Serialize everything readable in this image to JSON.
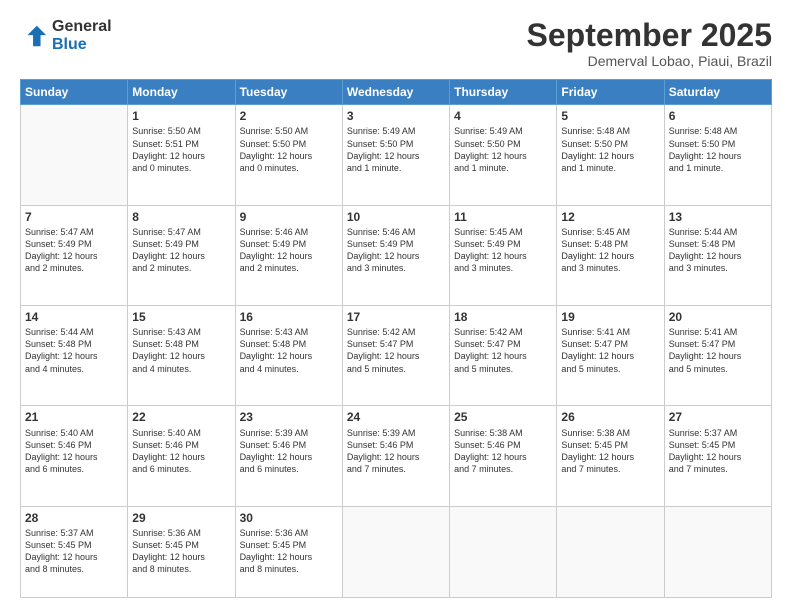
{
  "logo": {
    "general": "General",
    "blue": "Blue"
  },
  "header": {
    "month_title": "September 2025",
    "subtitle": "Demerval Lobao, Piaui, Brazil"
  },
  "days_of_week": [
    "Sunday",
    "Monday",
    "Tuesday",
    "Wednesday",
    "Thursday",
    "Friday",
    "Saturday"
  ],
  "weeks": [
    [
      {
        "day": "",
        "info": ""
      },
      {
        "day": "1",
        "info": "Sunrise: 5:50 AM\nSunset: 5:51 PM\nDaylight: 12 hours\nand 0 minutes."
      },
      {
        "day": "2",
        "info": "Sunrise: 5:50 AM\nSunset: 5:50 PM\nDaylight: 12 hours\nand 0 minutes."
      },
      {
        "day": "3",
        "info": "Sunrise: 5:49 AM\nSunset: 5:50 PM\nDaylight: 12 hours\nand 1 minute."
      },
      {
        "day": "4",
        "info": "Sunrise: 5:49 AM\nSunset: 5:50 PM\nDaylight: 12 hours\nand 1 minute."
      },
      {
        "day": "5",
        "info": "Sunrise: 5:48 AM\nSunset: 5:50 PM\nDaylight: 12 hours\nand 1 minute."
      },
      {
        "day": "6",
        "info": "Sunrise: 5:48 AM\nSunset: 5:50 PM\nDaylight: 12 hours\nand 1 minute."
      }
    ],
    [
      {
        "day": "7",
        "info": "Sunrise: 5:47 AM\nSunset: 5:49 PM\nDaylight: 12 hours\nand 2 minutes."
      },
      {
        "day": "8",
        "info": "Sunrise: 5:47 AM\nSunset: 5:49 PM\nDaylight: 12 hours\nand 2 minutes."
      },
      {
        "day": "9",
        "info": "Sunrise: 5:46 AM\nSunset: 5:49 PM\nDaylight: 12 hours\nand 2 minutes."
      },
      {
        "day": "10",
        "info": "Sunrise: 5:46 AM\nSunset: 5:49 PM\nDaylight: 12 hours\nand 3 minutes."
      },
      {
        "day": "11",
        "info": "Sunrise: 5:45 AM\nSunset: 5:49 PM\nDaylight: 12 hours\nand 3 minutes."
      },
      {
        "day": "12",
        "info": "Sunrise: 5:45 AM\nSunset: 5:48 PM\nDaylight: 12 hours\nand 3 minutes."
      },
      {
        "day": "13",
        "info": "Sunrise: 5:44 AM\nSunset: 5:48 PM\nDaylight: 12 hours\nand 3 minutes."
      }
    ],
    [
      {
        "day": "14",
        "info": "Sunrise: 5:44 AM\nSunset: 5:48 PM\nDaylight: 12 hours\nand 4 minutes."
      },
      {
        "day": "15",
        "info": "Sunrise: 5:43 AM\nSunset: 5:48 PM\nDaylight: 12 hours\nand 4 minutes."
      },
      {
        "day": "16",
        "info": "Sunrise: 5:43 AM\nSunset: 5:48 PM\nDaylight: 12 hours\nand 4 minutes."
      },
      {
        "day": "17",
        "info": "Sunrise: 5:42 AM\nSunset: 5:47 PM\nDaylight: 12 hours\nand 5 minutes."
      },
      {
        "day": "18",
        "info": "Sunrise: 5:42 AM\nSunset: 5:47 PM\nDaylight: 12 hours\nand 5 minutes."
      },
      {
        "day": "19",
        "info": "Sunrise: 5:41 AM\nSunset: 5:47 PM\nDaylight: 12 hours\nand 5 minutes."
      },
      {
        "day": "20",
        "info": "Sunrise: 5:41 AM\nSunset: 5:47 PM\nDaylight: 12 hours\nand 5 minutes."
      }
    ],
    [
      {
        "day": "21",
        "info": "Sunrise: 5:40 AM\nSunset: 5:46 PM\nDaylight: 12 hours\nand 6 minutes."
      },
      {
        "day": "22",
        "info": "Sunrise: 5:40 AM\nSunset: 5:46 PM\nDaylight: 12 hours\nand 6 minutes."
      },
      {
        "day": "23",
        "info": "Sunrise: 5:39 AM\nSunset: 5:46 PM\nDaylight: 12 hours\nand 6 minutes."
      },
      {
        "day": "24",
        "info": "Sunrise: 5:39 AM\nSunset: 5:46 PM\nDaylight: 12 hours\nand 7 minutes."
      },
      {
        "day": "25",
        "info": "Sunrise: 5:38 AM\nSunset: 5:46 PM\nDaylight: 12 hours\nand 7 minutes."
      },
      {
        "day": "26",
        "info": "Sunrise: 5:38 AM\nSunset: 5:45 PM\nDaylight: 12 hours\nand 7 minutes."
      },
      {
        "day": "27",
        "info": "Sunrise: 5:37 AM\nSunset: 5:45 PM\nDaylight: 12 hours\nand 7 minutes."
      }
    ],
    [
      {
        "day": "28",
        "info": "Sunrise: 5:37 AM\nSunset: 5:45 PM\nDaylight: 12 hours\nand 8 minutes."
      },
      {
        "day": "29",
        "info": "Sunrise: 5:36 AM\nSunset: 5:45 PM\nDaylight: 12 hours\nand 8 minutes."
      },
      {
        "day": "30",
        "info": "Sunrise: 5:36 AM\nSunset: 5:45 PM\nDaylight: 12 hours\nand 8 minutes."
      },
      {
        "day": "",
        "info": ""
      },
      {
        "day": "",
        "info": ""
      },
      {
        "day": "",
        "info": ""
      },
      {
        "day": "",
        "info": ""
      }
    ]
  ]
}
